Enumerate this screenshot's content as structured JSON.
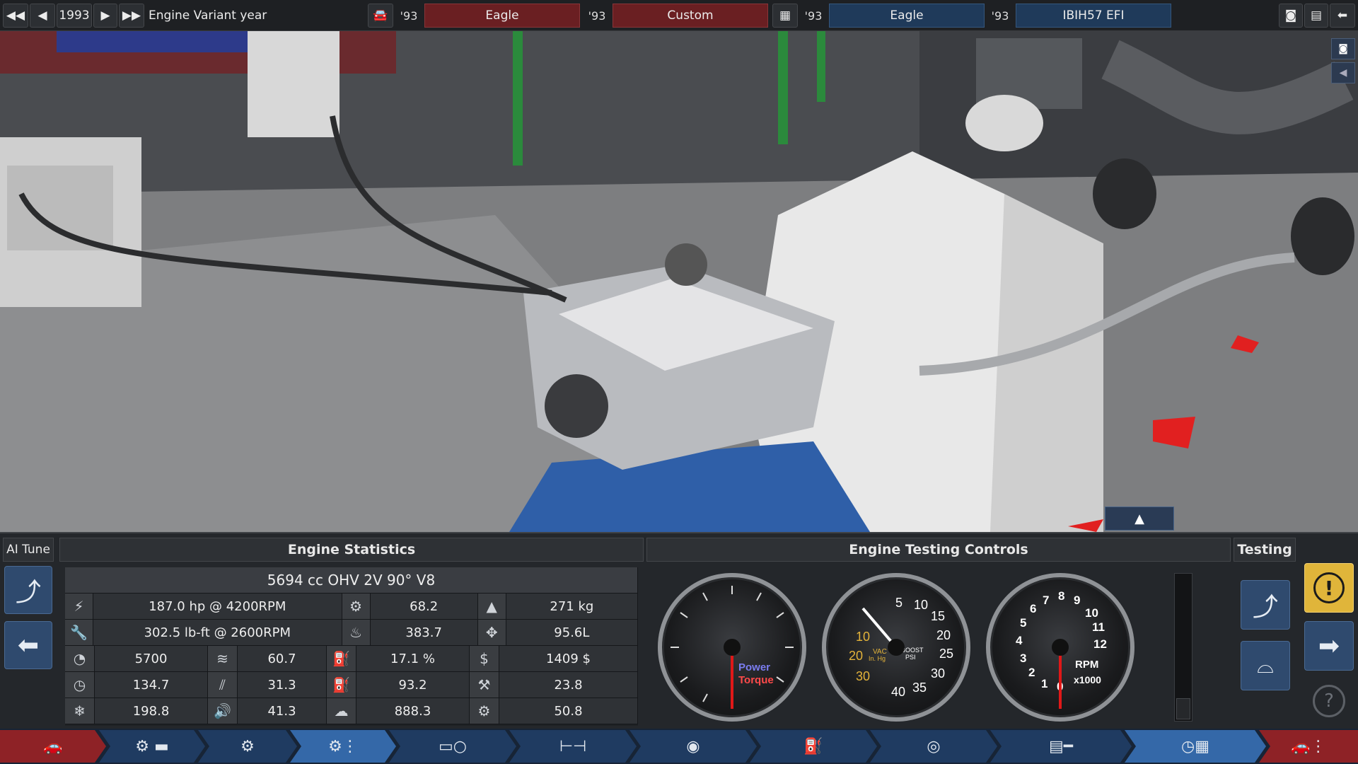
{
  "topbar": {
    "year": "1993",
    "variant_label": "Engine Variant year",
    "model_year_1": "'93",
    "model_name": "Eagle",
    "trim_year": "'93",
    "trim_name": "Custom",
    "family_year": "'93",
    "family_name": "Eagle",
    "engine_year": "'93",
    "engine_name": "IBIH57 EFI"
  },
  "panel": {
    "ai_tune": "AI Tune",
    "stats_title": "Engine Statistics",
    "testing_title": "Engine Testing Controls",
    "testing_label": "Testing",
    "engine_desc": "5694 cc OHV 2V 90° V8",
    "rows": [
      {
        "a": "187.0 hp @ 4200RPM",
        "b": "68.2",
        "c": "271 kg"
      },
      {
        "a": "302.5 lb-ft @ 2600RPM",
        "b": "383.7",
        "c": "95.6L"
      },
      {
        "a1": "5700",
        "a2": "60.7",
        "b": "17.1 %",
        "c": "1409 $"
      },
      {
        "a1": "134.7",
        "a2": "31.3",
        "b": "93.2",
        "c": "23.8"
      },
      {
        "a1": "198.8",
        "a2": "41.3",
        "b": "888.3",
        "c": "50.8"
      }
    ]
  },
  "gauges": {
    "power_label": "Power",
    "torque_label": "Torque",
    "vac_label": "VAC",
    "vac_unit": "In. Hg",
    "boost_label": "BOOST",
    "boost_unit": "PSI",
    "rpm_label": "RPM",
    "rpm_unit": "x1000",
    "boost_ticks": [
      "5",
      "10",
      "15",
      "20",
      "25",
      "30",
      "35",
      "40"
    ],
    "vac_ticks": [
      "10",
      "20",
      "30"
    ],
    "rpm_ticks": [
      "0",
      "1",
      "2",
      "3",
      "4",
      "5",
      "6",
      "7",
      "8",
      "9",
      "10",
      "11",
      "12"
    ]
  },
  "colors": {
    "accent": "#3468a8",
    "red_field": "#6a1f22",
    "blue_field": "#1f3a5a",
    "warn": "#e0b53a"
  }
}
